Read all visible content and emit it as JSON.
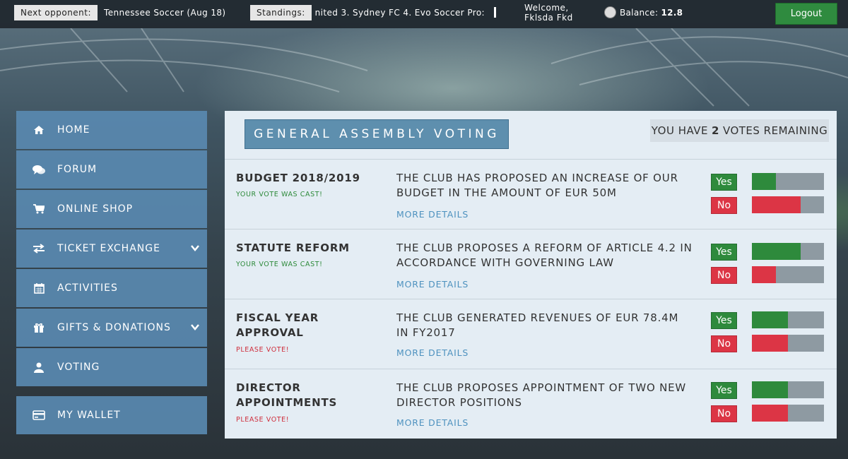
{
  "topbar": {
    "next_opponent_label": "Next opponent:",
    "next_opponent_value": "Tennessee Soccer (Aug 18)",
    "standings_label": "Standings:",
    "standings_value": "nited 3. Sydney FC 4. Evo Soccer Pro:",
    "welcome_line1": "Welcome,",
    "welcome_line2": "Fklsda Fkd",
    "balance_label": "Balance:",
    "balance_value": "12.8",
    "logout_label": "Logout",
    "coin_icon": "coin-icon"
  },
  "sidebar": {
    "items": [
      {
        "label": "HOME",
        "icon": "home-icon"
      },
      {
        "label": "FORUM",
        "icon": "chat-icon"
      },
      {
        "label": "ONLINE SHOP",
        "icon": "cart-icon"
      },
      {
        "label": "TICKET EXCHANGE",
        "icon": "exchange-icon"
      },
      {
        "label": "ACTIVITIES",
        "icon": "calendar-icon"
      },
      {
        "label": "GIFTS & DONATIONS",
        "icon": "gift-icon"
      },
      {
        "label": "VOTING",
        "icon": "user-icon"
      }
    ],
    "wallet": {
      "label": "MY WALLET",
      "icon": "credit-card-icon"
    }
  },
  "main": {
    "title": "GENERAL ASSEMBLY VOTING",
    "votes_prefix": "YOU HAVE",
    "votes_count": "2",
    "votes_suffix": "VOTES REMAINING",
    "yes_label": "Yes",
    "no_label": "No",
    "more_details_label": "MORE DETAILS",
    "proposals": [
      {
        "title": "BUDGET 2018/2019",
        "status": "YOUR VOTE WAS CAST!",
        "description": "THE CLUB HAS PROPOSED AN INCREASE OF OUR BUDGET IN THE AMOUNT OF EUR 50M",
        "yes_share": 0.33,
        "no_share": 0.68
      },
      {
        "title": "STATUTE REFORM",
        "status": "YOUR VOTE WAS CAST!",
        "description": "THE CLUB PROPOSES A REFORM OF ARTICLE 4.2 IN ACCORDANCE WITH GOVERNING LAW",
        "yes_share": 0.68,
        "no_share": 0.33
      },
      {
        "title": "FISCAL YEAR APPROVAL",
        "status": "PLEASE VOTE!",
        "description": "THE CLUB GENERATED REVENUES OF EUR 78.4M IN FY2017",
        "yes_share": 0.5,
        "no_share": 0.5
      },
      {
        "title": "DIRECTOR APPOINTMENTS",
        "status": "PLEASE VOTE!",
        "description": "THE CLUB PROPOSES APPOINTMENT OF TWO NEW DIRECTOR POSITIONS",
        "yes_share": 0.5,
        "no_share": 0.5
      }
    ]
  },
  "colors": {
    "nav_bg": "#5989b0",
    "yes": "#2e8a3c",
    "no": "#dc3545",
    "link": "#4e92bf"
  }
}
